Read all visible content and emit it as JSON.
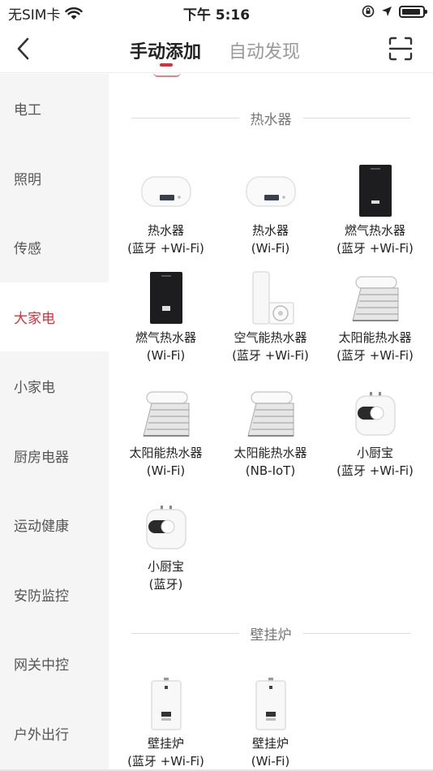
{
  "status_bar": {
    "carrier": "无SIM卡",
    "time": "下午 5:16"
  },
  "header": {
    "tab_manual": "手动添加",
    "tab_auto": "自动发现"
  },
  "sidebar": {
    "items": [
      {
        "label": "电工"
      },
      {
        "label": "照明"
      },
      {
        "label": "传感"
      },
      {
        "label": "大家电",
        "active": true
      },
      {
        "label": "小家电"
      },
      {
        "label": "厨房电器"
      },
      {
        "label": "运动健康"
      },
      {
        "label": "安防监控"
      },
      {
        "label": "网关中控"
      },
      {
        "label": "户外出行"
      }
    ]
  },
  "sections": [
    {
      "title": "热水器",
      "devices": [
        {
          "name": "热水器",
          "conn": "(蓝牙 +Wi-Fi)",
          "icon": "electric-water-heater"
        },
        {
          "name": "热水器",
          "conn": "(Wi-Fi)",
          "icon": "electric-water-heater"
        },
        {
          "name": "燃气热水器",
          "conn": "(蓝牙 +Wi-Fi)",
          "icon": "gas-water-heater"
        },
        {
          "name": "燃气热水器",
          "conn": "(Wi-Fi)",
          "icon": "gas-water-heater"
        },
        {
          "name": "空气能热水器",
          "conn": "(蓝牙 +Wi-Fi)",
          "icon": "air-source-heater"
        },
        {
          "name": "太阳能热水器",
          "conn": "(蓝牙 +Wi-Fi)",
          "icon": "solar-water-heater"
        },
        {
          "name": "太阳能热水器",
          "conn": "(Wi-Fi)",
          "icon": "solar-water-heater"
        },
        {
          "name": "太阳能热水器",
          "conn": "(NB-IoT)",
          "icon": "solar-water-heater"
        },
        {
          "name": "小厨宝",
          "conn": "(蓝牙 +Wi-Fi)",
          "icon": "kitchen-heater"
        },
        {
          "name": "小厨宝",
          "conn": "(蓝牙)",
          "icon": "kitchen-heater"
        }
      ]
    },
    {
      "title": "壁挂炉",
      "devices": [
        {
          "name": "壁挂炉",
          "conn": "(蓝牙 +Wi-Fi)",
          "icon": "wall-boiler"
        },
        {
          "name": "壁挂炉",
          "conn": "(Wi-Fi)",
          "icon": "wall-boiler"
        }
      ]
    }
  ],
  "colors": {
    "accent": "#d6323a",
    "sidebar_bg": "#f5f5f5"
  }
}
